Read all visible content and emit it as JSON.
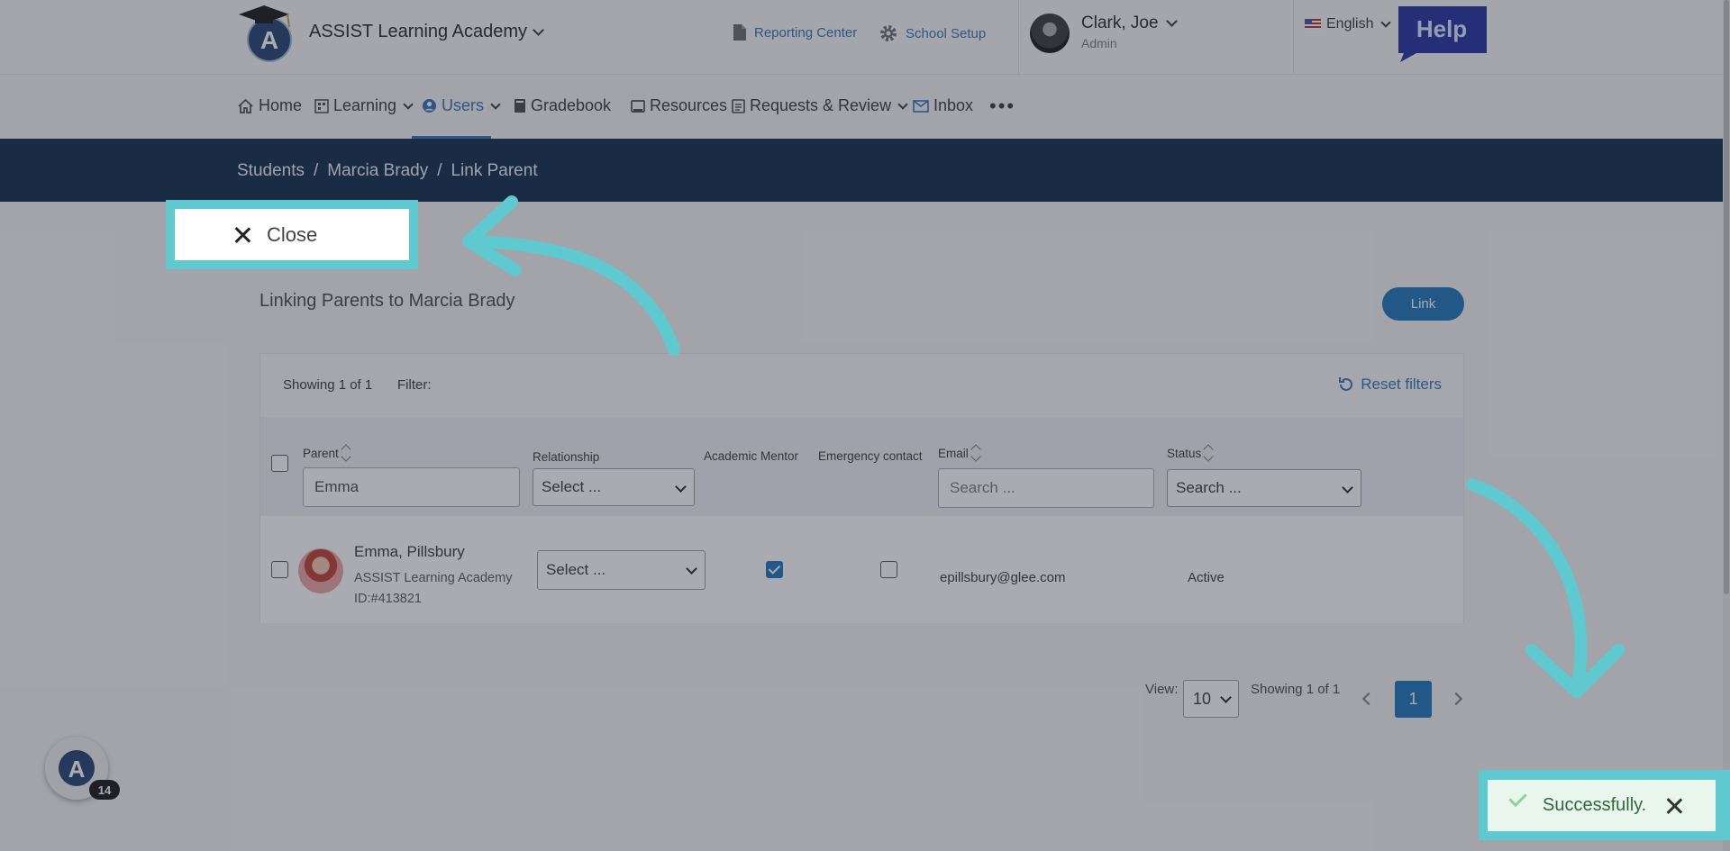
{
  "header": {
    "school_name": "ASSIST Learning Academy",
    "reporting_center": "Reporting Center",
    "school_setup": "School Setup",
    "user_name": "Clark, Joe",
    "user_role": "Admin",
    "language": "English",
    "help_label": "Help"
  },
  "nav": {
    "items": [
      {
        "label": "Home"
      },
      {
        "label": "Learning"
      },
      {
        "label": "Users"
      },
      {
        "label": "Gradebook"
      },
      {
        "label": "Resources"
      },
      {
        "label": "Requests & Review"
      },
      {
        "label": "Inbox"
      }
    ],
    "more": "•••"
  },
  "breadcrumb": {
    "items": [
      "Students",
      "Marcia Brady",
      "Link Parent"
    ],
    "separator": "/"
  },
  "close_label": "Close",
  "page": {
    "heading": "Linking Parents to Marcia Brady",
    "link_button": "Link"
  },
  "table": {
    "showing": "Showing 1 of 1",
    "filter_label": "Filter:",
    "reset_filters": "Reset filters",
    "columns": [
      "Parent",
      "Relationship",
      "Academic Mentor",
      "Emergency contact",
      "Email",
      "Status"
    ],
    "filters": {
      "parent_value": "Emma",
      "relationship": "Select ...",
      "email_placeholder": "Search ...",
      "status": "Search ..."
    },
    "rows": [
      {
        "name": "Emma, Pillsbury",
        "school": "ASSIST Learning Academy",
        "id": "ID:#413821",
        "relationship": "Select ...",
        "academic_mentor": true,
        "emergency_contact": false,
        "email": "epillsbury@glee.com",
        "status": "Active"
      }
    ]
  },
  "pagination": {
    "view_label": "View:",
    "page_size": "10",
    "showing": "Showing 1 of 1",
    "current_page": "1"
  },
  "toast": {
    "message": "Successfully."
  },
  "fab": {
    "badge": "14"
  },
  "colors": {
    "primary": "#1670b8",
    "navy": "#0a2545",
    "highlight": "#5ec9cf",
    "success_bg": "#e9f6ec"
  }
}
